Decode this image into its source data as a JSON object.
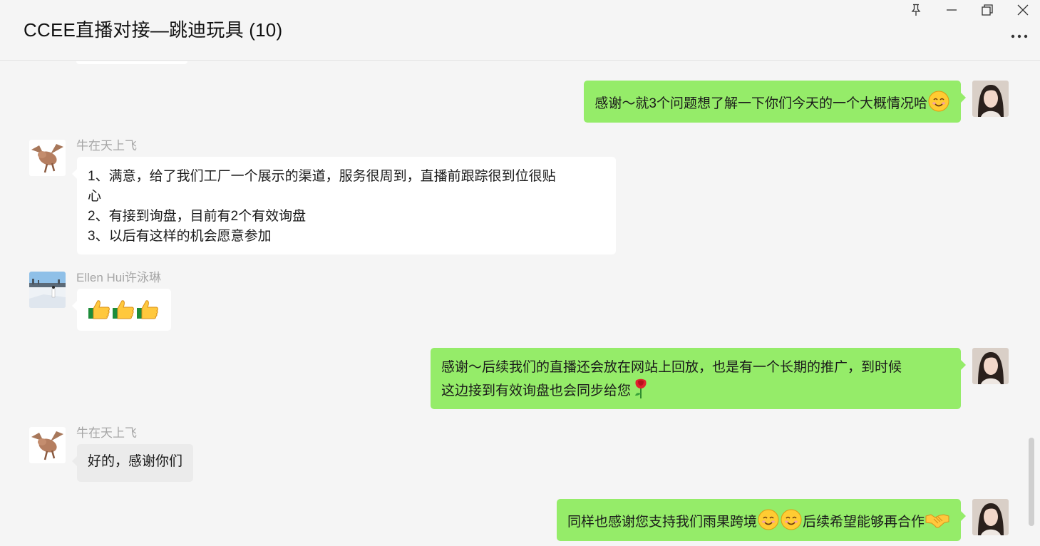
{
  "window": {
    "title": "CCEE直播对接—跳迪玩具 (10)",
    "controls": [
      "pin-icon",
      "minimize-icon",
      "restore-icon",
      "close-icon"
    ],
    "more_icon": "more-dots-icon"
  },
  "colors": {
    "background": "#f5f5f5",
    "incoming_bubble": "#ffffff",
    "outgoing_bubble": "#95ec69",
    "sender_name": "#a6a6a6"
  },
  "messages": [
    {
      "direction": "out",
      "text_lines": [
        "感谢～就3个问题想了解一下你们今天的一个大概情况哈"
      ],
      "emojis": [
        "smile-emoji"
      ]
    },
    {
      "direction": "in",
      "sender": "牛在天上飞",
      "text_lines": [
        "1、满意，给了我们工厂一个展示的渠道，服务很周到，直播前跟踪很到位很贴",
        "心",
        "2、有接到询盘，目前有2个有效询盘",
        "3、以后有这样的机会愿意参加"
      ]
    },
    {
      "direction": "in",
      "sender": "Ellen Hui许泳琳",
      "emojis": [
        "thumbs-up-emoji",
        "thumbs-up-emoji",
        "thumbs-up-emoji"
      ]
    },
    {
      "direction": "out",
      "text_lines": [
        "感谢～后续我们的直播还会放在网站上回放，也是有一个长期的推广，到时候",
        "这边接到有效询盘也会同步给您"
      ],
      "emojis": [
        "rose-emoji"
      ]
    },
    {
      "direction": "in",
      "sender": "牛在天上飞",
      "text_lines": [
        "好的，感谢你们"
      ]
    },
    {
      "direction": "out",
      "text_parts": [
        "同样也感谢您支持我们雨果跨境",
        "后续希望能够再合作"
      ],
      "emojis": [
        "smile-emoji",
        "smile-emoji",
        "handshake-emoji"
      ]
    }
  ]
}
